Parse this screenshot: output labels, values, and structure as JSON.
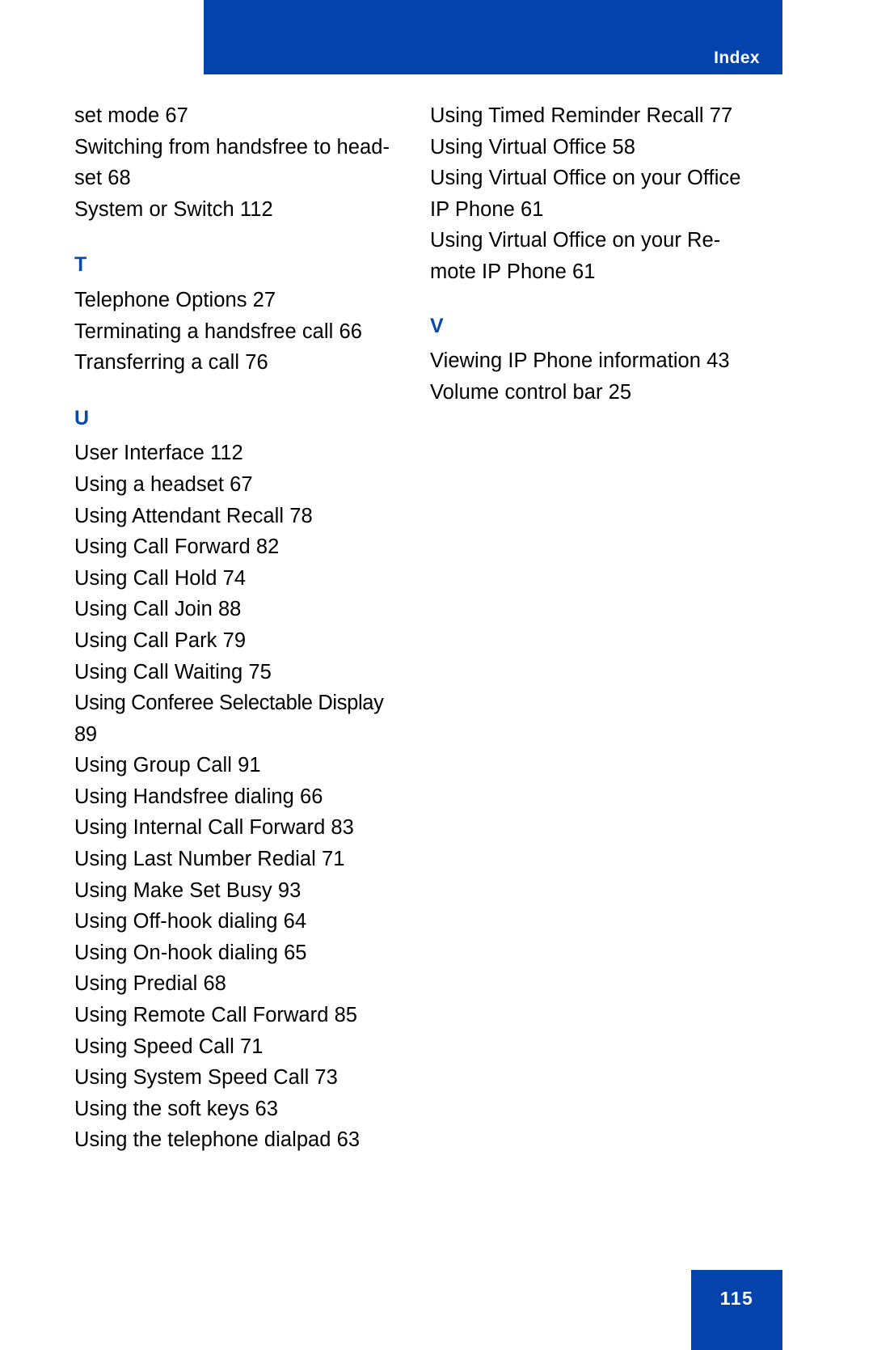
{
  "header": {
    "title": "Index"
  },
  "footer": {
    "page_number": "115"
  },
  "colors": {
    "brand_blue": "#0442ac",
    "section_letter_blue": "#0b4aa8",
    "text_black": "#000000",
    "page_background": "#ffffff"
  },
  "columns": {
    "left": {
      "continued_entries": [
        {
          "text": "set mode 67"
        },
        {
          "text": "Switching from handsfree to head-\nset 68"
        },
        {
          "text": "System or Switch 112"
        }
      ],
      "sections": [
        {
          "letter": "T",
          "entries": [
            {
              "text": "Telephone Options 27"
            },
            {
              "text": "Terminating a handsfree call 66"
            },
            {
              "text": "Transferring a call 76"
            }
          ]
        },
        {
          "letter": "U",
          "entries": [
            {
              "text": "User Interface 112"
            },
            {
              "text": "Using a headset 67"
            },
            {
              "text": "Using Attendant Recall 78"
            },
            {
              "text": "Using Call Forward 82"
            },
            {
              "text": "Using Call Hold 74"
            },
            {
              "text": "Using Call Join 88"
            },
            {
              "text": "Using Call Park 79"
            },
            {
              "text": "Using Call Waiting 75"
            },
            {
              "text": "Using Conferee Selectable Display\n89",
              "condensed": true
            },
            {
              "text": "Using Group Call 91"
            },
            {
              "text": "Using Handsfree dialing 66"
            },
            {
              "text": "Using Internal Call Forward 83"
            },
            {
              "text": "Using Last Number Redial 71"
            },
            {
              "text": "Using Make Set Busy 93"
            },
            {
              "text": "Using Off-hook dialing 64"
            },
            {
              "text": "Using On-hook dialing 65"
            },
            {
              "text": "Using Predial 68"
            },
            {
              "text": "Using Remote Call Forward 85"
            },
            {
              "text": "Using Speed Call 71"
            },
            {
              "text": "Using System Speed Call 73"
            },
            {
              "text": "Using the soft keys 63"
            },
            {
              "text": "Using the telephone dialpad 63"
            }
          ]
        }
      ]
    },
    "right": {
      "continued_entries": [
        {
          "text": "Using Timed Reminder Recall 77"
        },
        {
          "text": "Using Virtual Office 58"
        },
        {
          "text": "Using Virtual Office on your Office\nIP Phone 61"
        },
        {
          "text": "Using Virtual Office on your Re-\nmote IP Phone 61"
        }
      ],
      "sections": [
        {
          "letter": "V",
          "entries": [
            {
              "text": "Viewing IP Phone information 43"
            },
            {
              "text": "Volume control bar 25"
            }
          ]
        }
      ]
    }
  }
}
